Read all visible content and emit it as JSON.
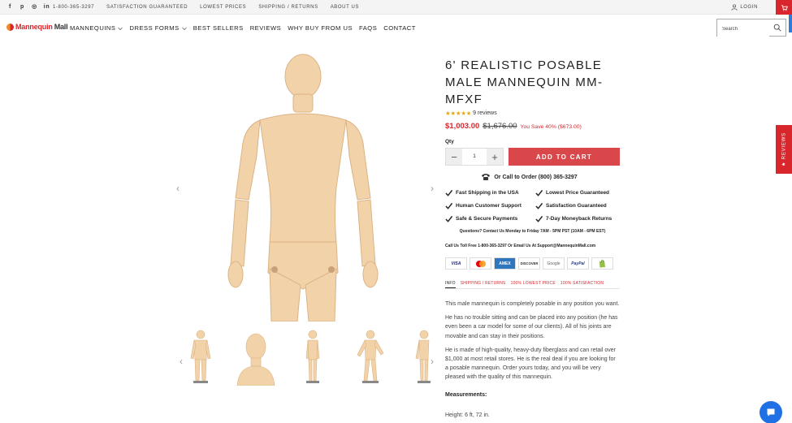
{
  "topbar": {
    "social": [
      "facebook-icon",
      "pinterest-icon",
      "instagram-icon",
      "linkedin-icon"
    ],
    "phone": "1-800-365-3297",
    "links": [
      "SATISFACTION GUARANTEED",
      "LOWEST PRICES",
      "SHIPPING / RETURNS",
      "ABOUT US"
    ],
    "login": "LOGIN",
    "cart_count": "0"
  },
  "header": {
    "logo_part1": "Mannequin",
    "logo_part2": "Mall",
    "nav": [
      {
        "label": "MANNEQUINS"
      },
      {
        "label": "DRESS FORMS"
      },
      {
        "label": "BEST SELLERS"
      },
      {
        "label": "REVIEWS"
      },
      {
        "label": "WHY BUY FROM US"
      },
      {
        "label": "FAQS"
      },
      {
        "label": "CONTACT"
      }
    ],
    "search_placeholder": "Search"
  },
  "product": {
    "title": "6' REALISTIC POSABLE MALE MANNEQUIN MM-MFXF",
    "stars": "★★★★★",
    "reviews": "9 reviews",
    "price": "$1,003.00",
    "compare_price": "$1,676.00",
    "save": "You Save 40% ($673.00)",
    "qty_label": "Qty",
    "qty_value": "1",
    "add_to_cart": "ADD TO CART",
    "call": "Or Call to Order (800) 365-3297",
    "features": [
      "Fast Shipping in the USA",
      "Lowest Price Guaranteed",
      "Human Customer Support",
      "Satisfaction Guaranteed",
      "Safe & Secure Payments",
      "7-Day Moneyback Returns"
    ],
    "contact_hours": "Questions? Contact Us Monday to Friday 7AM - 5PM PST (10AM - 6PM EST)",
    "contact_line": "Call Us Toll Free 1-800-365-3297 Or Email Us At Support@MannequinMall.com",
    "payments": [
      "VISA",
      "MC",
      "AMEX",
      "DISCOVER",
      "Google",
      "PayPal",
      "Shopify"
    ],
    "tabs": [
      "INFO",
      "SHIPPING / RETURNS",
      "100% LOWEST PRICE",
      "100% SATISFACTION"
    ],
    "description": [
      "This male mannequin is completely posable in any position you want.",
      "He has no trouble sitting and can be placed into any position (he has even been a car model for some of our clients). All of his joints are movable and can stay in their positions.",
      "He is made of high-quality, heavy-duty fiberglass and can retail over $1,000 at most retail stores. He is the real deal if you are looking for a posable mannequin. Order yours today, and you will be very pleased with the quality of this mannequin."
    ],
    "measurements_label": "Measurements:",
    "height": "Height: 6 ft, 72 in."
  },
  "reviews_tab": "★ REVIEWS",
  "colors": {
    "accent": "#d9262c",
    "button": "#d9474a",
    "chat": "#1f6fe5",
    "skin": "#f2d2a8"
  }
}
